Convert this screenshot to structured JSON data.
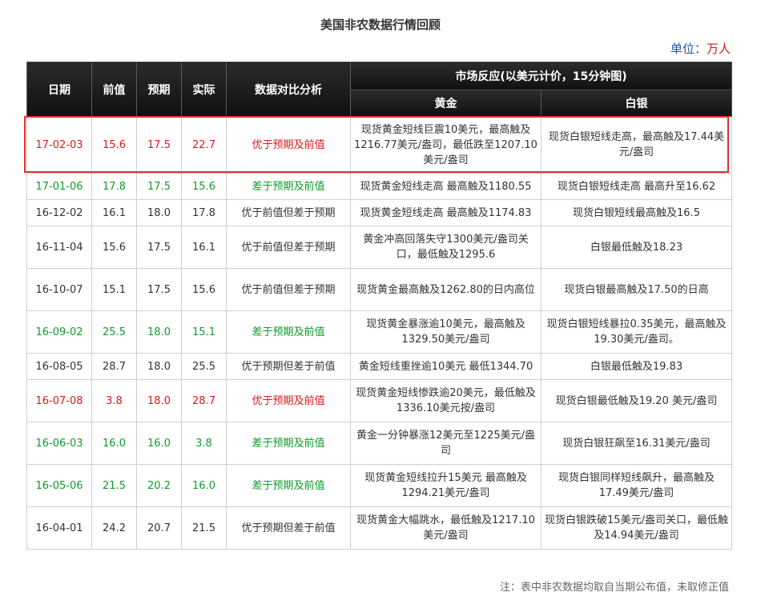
{
  "title": "美国非农数据行情回顾",
  "unit_label": "单位：",
  "unit_value": "万人",
  "headers": {
    "date": "日期",
    "prev": "前值",
    "forecast": "预期",
    "actual": "实际",
    "analysis": "数据对比分析",
    "market": "市场反应(以美元计价，15分钟图)",
    "gold": "黄金",
    "silver": "白银"
  },
  "rows": [
    {
      "date": "17-02-03",
      "prev": "15.6",
      "forecast": "17.5",
      "actual": "22.7",
      "analysis": "优于预期及前值",
      "gold": "现货黄金短线巨震10美元，最高触及1216.77美元/盎司，最低跌至1207.10美元/盎司",
      "silver": "现货白银短线走高，最高触及17.44美元/盎司",
      "color": "red"
    },
    {
      "date": "17-01-06",
      "prev": "17.8",
      "forecast": "17.5",
      "actual": "15.6",
      "analysis": "差于预期及前值",
      "gold": "现货黄金短线走高 最高触及1180.55",
      "silver": "现货白银短线走高 最高升至16.62",
      "color": "green"
    },
    {
      "date": "16-12-02",
      "prev": "16.1",
      "forecast": "18.0",
      "actual": "17.8",
      "analysis": "优于前值但差于预期",
      "gold": "现货黄金短线走高 最高触及1174.83",
      "silver": "现货白银短线最高触及16.5",
      "color": "normal"
    },
    {
      "date": "16-11-04",
      "prev": "15.6",
      "forecast": "17.5",
      "actual": "16.1",
      "analysis": "优于前值但差于预期",
      "gold": "黄金冲高回落失守1300美元/盎司关口，最低触及1295.6",
      "silver": "白银最低触及18.23",
      "color": "normal"
    },
    {
      "date": "16-10-07",
      "prev": "15.1",
      "forecast": "17.5",
      "actual": "15.6",
      "analysis": "优于前值但差于预期",
      "gold": "现货黄金最高触及1262.80的日内高位",
      "silver": "现货白银最高触及17.50的日高",
      "color": "normal"
    },
    {
      "date": "16-09-02",
      "prev": "25.5",
      "forecast": "18.0",
      "actual": "15.1",
      "analysis": "差于预期及前值",
      "gold": "现货黄金暴涨逾10美元，最高触及1329.50美元/盎司",
      "silver": "现货白银短线暴拉0.35美元，最高触及19.30美元/盎司。",
      "color": "green"
    },
    {
      "date": "16-08-05",
      "prev": "28.7",
      "forecast": "18.0",
      "actual": "25.5",
      "analysis": "优于预期但差于前值",
      "gold": "黄金短线重挫逾10美元 最低1344.70",
      "silver": "白银最低触及19.83",
      "color": "normal"
    },
    {
      "date": "16-07-08",
      "prev": "3.8",
      "forecast": "18.0",
      "actual": "28.7",
      "analysis": "优于预期及前值",
      "gold": "现货黄金短线惨跌逾20美元，最低触及1336.10美元按/盎司",
      "silver": "现货白银最低触及19.20 美元/盎司",
      "color": "red"
    },
    {
      "date": "16-06-03",
      "prev": "16.0",
      "forecast": "16.0",
      "actual": "3.8",
      "analysis": "差于预期及前值",
      "gold": "黄金一分钟暴涨12美元至1225美元/盎司",
      "silver": "现货白银狂飙至16.31美元/盎司",
      "color": "green"
    },
    {
      "date": "16-05-06",
      "prev": "21.5",
      "forecast": "20.2",
      "actual": "16.0",
      "analysis": "差于预期及前值",
      "gold": "现货黄金短线拉升15美元 最高触及1294.21美元/盎司",
      "silver": "现货白银同样短线飙升，最高触及17.49美元/盎司",
      "color": "green"
    },
    {
      "date": "16-04-01",
      "prev": "24.2",
      "forecast": "20.7",
      "actual": "21.5",
      "analysis": "优于预期但差于前值",
      "gold": "现货黄金大幅跳水，最低触及1217.10美元/盎司",
      "silver": "现货白银跌破15美元/盎司关口，最低触及14.94美元/盎司",
      "color": "normal"
    }
  ],
  "note": "注：表中非农数据均取自当期公布值，未取修正值"
}
